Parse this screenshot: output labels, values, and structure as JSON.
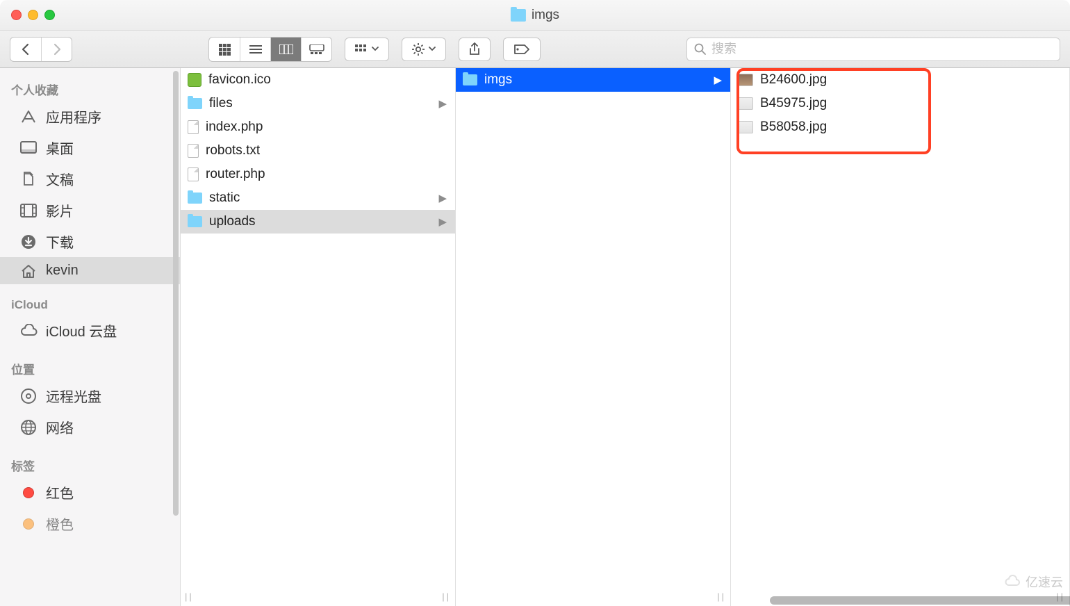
{
  "window": {
    "title": "imgs"
  },
  "search": {
    "placeholder": "搜索"
  },
  "sidebar": {
    "sections": [
      {
        "header": "个人收藏",
        "items": [
          {
            "icon": "apps",
            "label": "应用程序"
          },
          {
            "icon": "desktop",
            "label": "桌面"
          },
          {
            "icon": "docs",
            "label": "文稿"
          },
          {
            "icon": "movies",
            "label": "影片"
          },
          {
            "icon": "download",
            "label": "下载"
          },
          {
            "icon": "home",
            "label": "kevin",
            "selected": true
          }
        ]
      },
      {
        "header": "iCloud",
        "items": [
          {
            "icon": "cloud",
            "label": "iCloud 云盘"
          }
        ]
      },
      {
        "header": "位置",
        "items": [
          {
            "icon": "disc",
            "label": "远程光盘"
          },
          {
            "icon": "globe",
            "label": "网络"
          }
        ]
      },
      {
        "header": "标签",
        "items": [
          {
            "icon": "tag-red",
            "label": "红色"
          },
          {
            "icon": "tag-orange",
            "label": "橙色"
          }
        ]
      }
    ]
  },
  "columns": {
    "col1": [
      {
        "type": "ico",
        "name": "favicon.ico"
      },
      {
        "type": "folder",
        "name": "files",
        "hasChildren": true
      },
      {
        "type": "page",
        "name": "index.php"
      },
      {
        "type": "page",
        "name": "robots.txt"
      },
      {
        "type": "page",
        "name": "router.php"
      },
      {
        "type": "folder",
        "name": "static",
        "hasChildren": true
      },
      {
        "type": "folder",
        "name": "uploads",
        "hasChildren": true,
        "selectedGray": true
      }
    ],
    "col2": [
      {
        "type": "folder",
        "name": "imgs",
        "hasChildren": true,
        "selectedBlue": true
      }
    ],
    "col3": [
      {
        "type": "thumb-photo",
        "name": "B24600.jpg"
      },
      {
        "type": "thumb",
        "name": "B45975.jpg"
      },
      {
        "type": "thumb",
        "name": "B58058.jpg"
      }
    ]
  },
  "watermark": "亿速云"
}
